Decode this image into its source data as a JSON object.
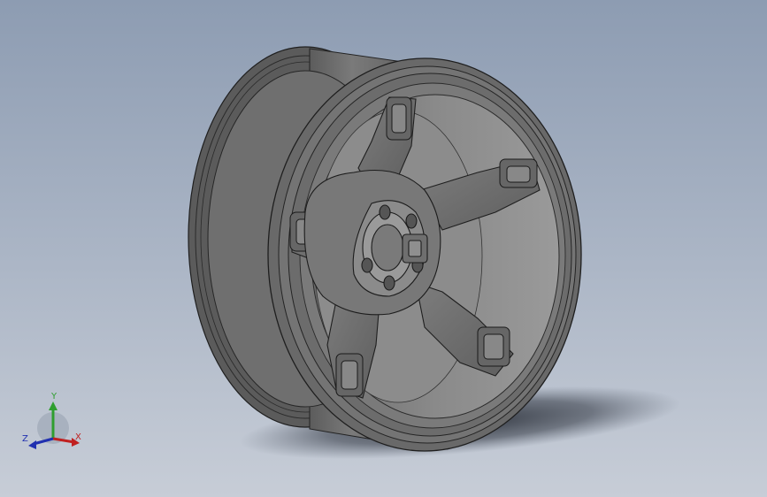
{
  "viewport": {
    "background_top": "#8d9cb2",
    "background_bottom": "#c7cdd7",
    "model_color": "#6e6e6e"
  },
  "model": {
    "icon": "wheel-rim-model-icon"
  },
  "triad": {
    "x_label": "X",
    "y_label": "Y",
    "z_label": "Z",
    "x_color": "#c02020",
    "y_color": "#2f9e2f",
    "z_color": "#2030b0"
  }
}
